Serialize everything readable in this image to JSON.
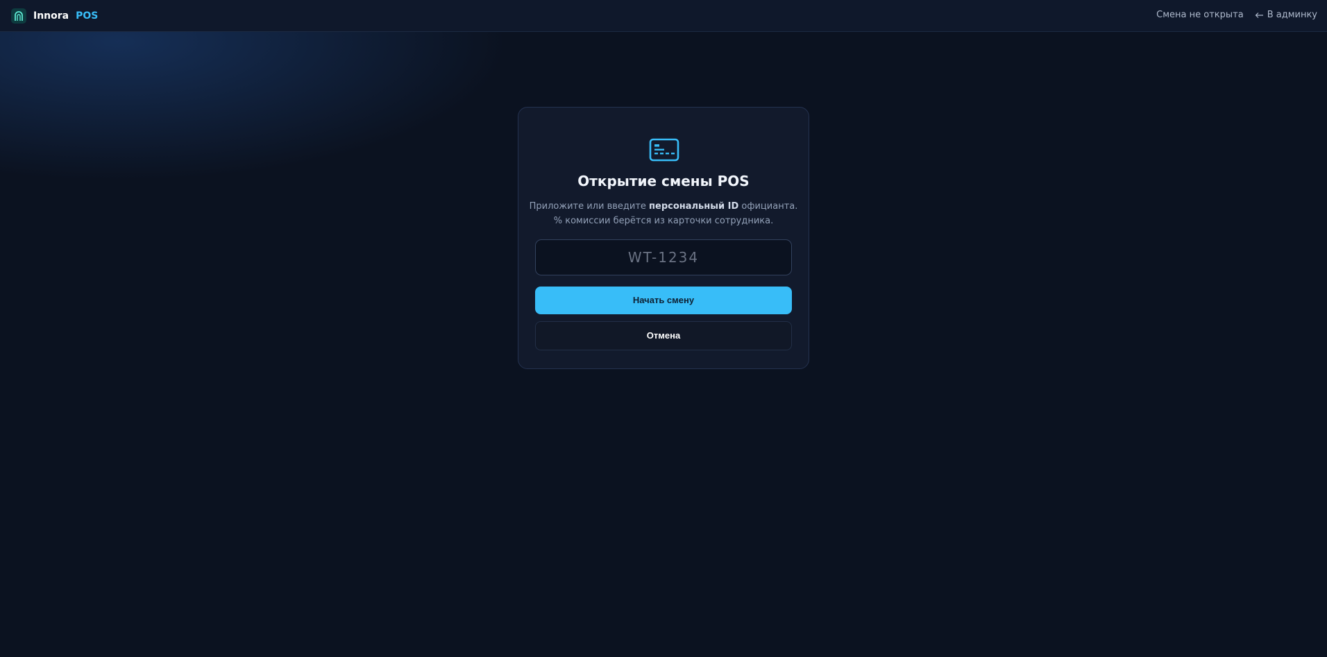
{
  "header": {
    "brand_name": "Innora",
    "brand_product": "POS",
    "shift_status": "Смена не открыта",
    "admin_link": "В админку"
  },
  "card": {
    "title": "Открытие смены POS",
    "desc_prefix": "Приложите или введите ",
    "desc_bold": "персональный ID",
    "desc_suffix": " официанта.",
    "desc_line2": "% комиссии берётся из карточки сотрудника.",
    "id_input": {
      "value": "",
      "placeholder": "WT-1234"
    },
    "start_button": "Начать смену",
    "cancel_button": "Отмена"
  },
  "icons": {
    "logo": "arch-logo-icon",
    "back": "arrow-left-icon",
    "card": "id-card-icon"
  },
  "colors": {
    "accent": "#38bdf8",
    "background": "#0b1220",
    "card": "#121a2c",
    "topbar": "#0f182b"
  }
}
